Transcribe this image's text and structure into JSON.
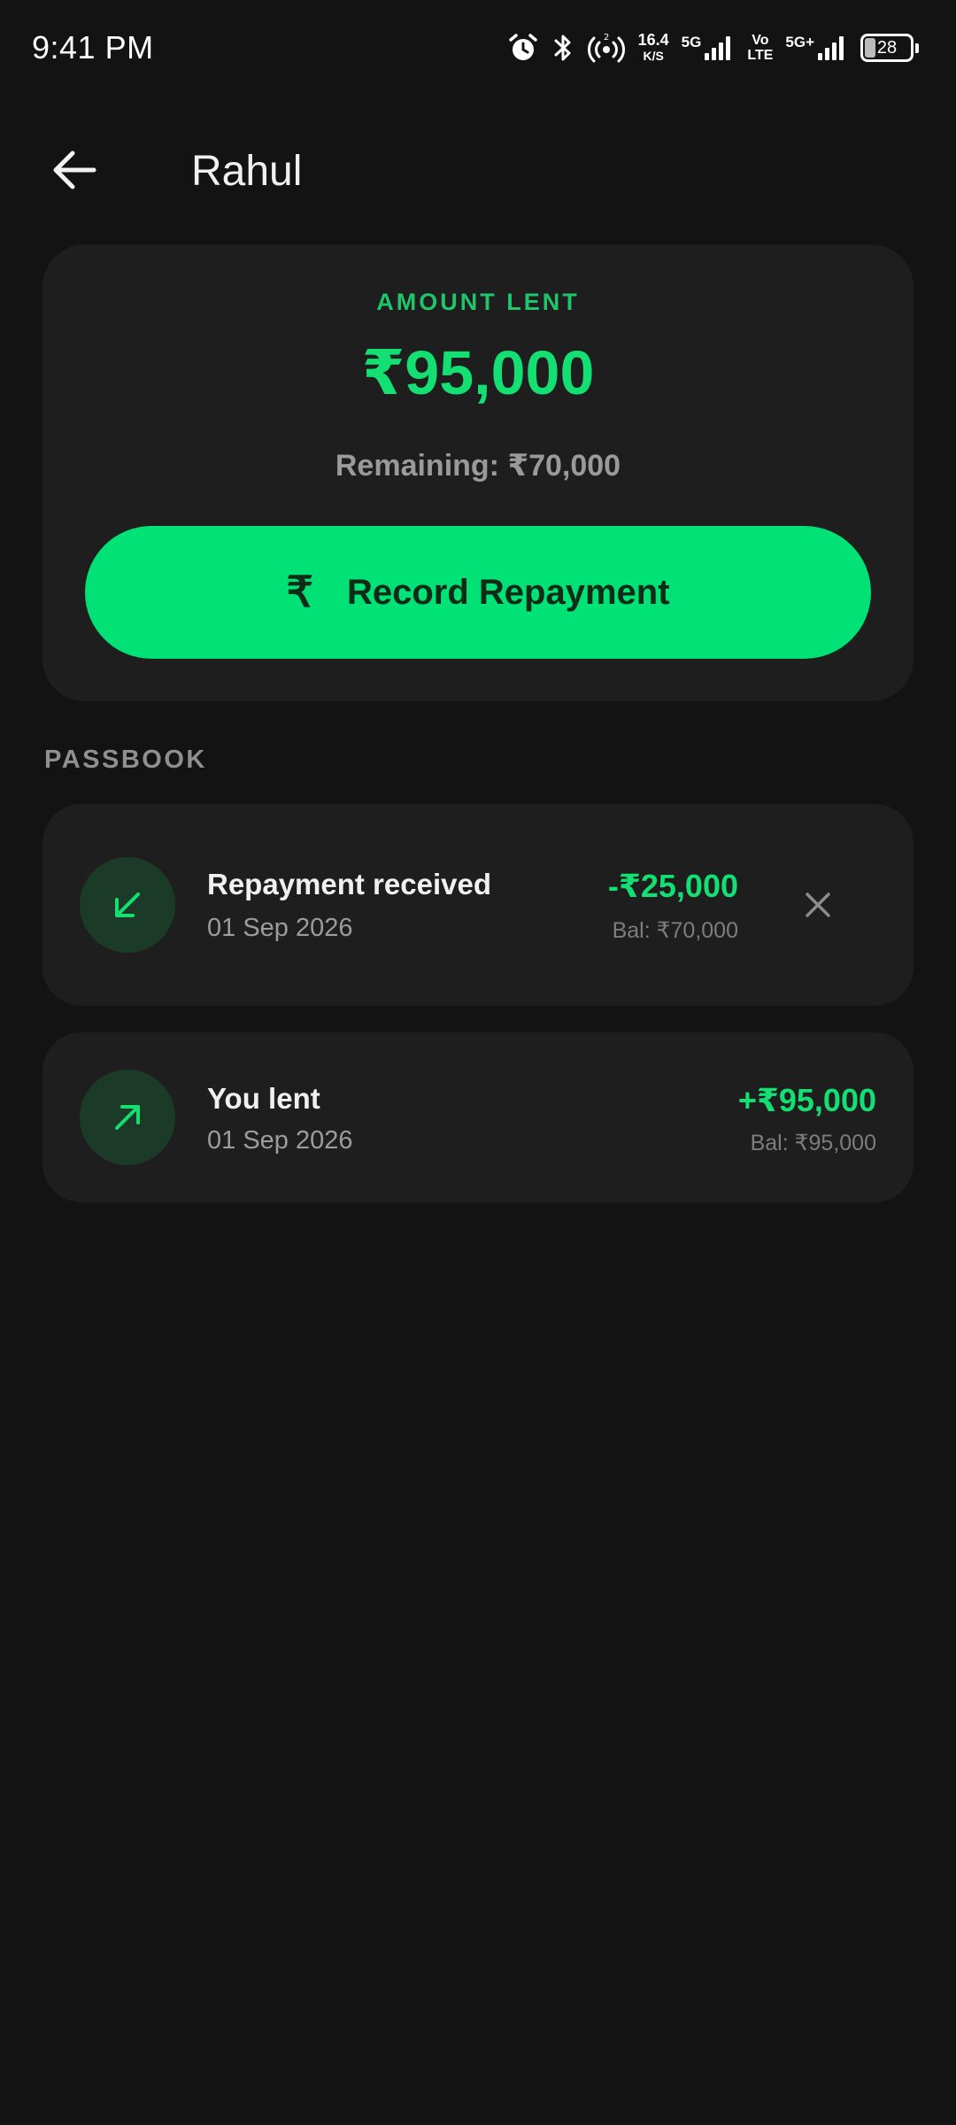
{
  "status_bar": {
    "time": "9:41 PM",
    "net_speed_value": "16.4",
    "net_speed_unit": "K/S",
    "sim1_label": "5G",
    "volte_top": "Vo",
    "volte_bottom": "LTE",
    "sim2_label": "5G+",
    "battery_level": "28",
    "icons": [
      "alarm-icon",
      "bluetooth-icon",
      "hotspot-icon",
      "signal-icon",
      "battery-icon"
    ]
  },
  "header": {
    "title": "Rahul",
    "back_icon": "arrow-left-icon"
  },
  "summary": {
    "label": "AMOUNT LENT",
    "amount": "₹95,000",
    "remaining": "Remaining: ₹70,000",
    "button_icon": "₹",
    "button_label": "Record Repayment"
  },
  "passbook": {
    "title": "PASSBOOK",
    "entries": [
      {
        "title": "Repayment received",
        "date": "01 Sep 2026",
        "amount": "-₹25,000",
        "balance": "Bal: ₹70,000",
        "icon": "arrow-down-left-icon",
        "deletable": true
      },
      {
        "title": "You lent",
        "date": "01 Sep 2026",
        "amount": "+₹95,000",
        "balance": "Bal: ₹95,000",
        "icon": "arrow-up-right-icon",
        "deletable": false
      }
    ]
  },
  "colors": {
    "background": "#131313",
    "card": "#1e1e1e",
    "accent": "#00e276",
    "accent_text": "#13df72",
    "icon_circle": "#1c3a28"
  }
}
